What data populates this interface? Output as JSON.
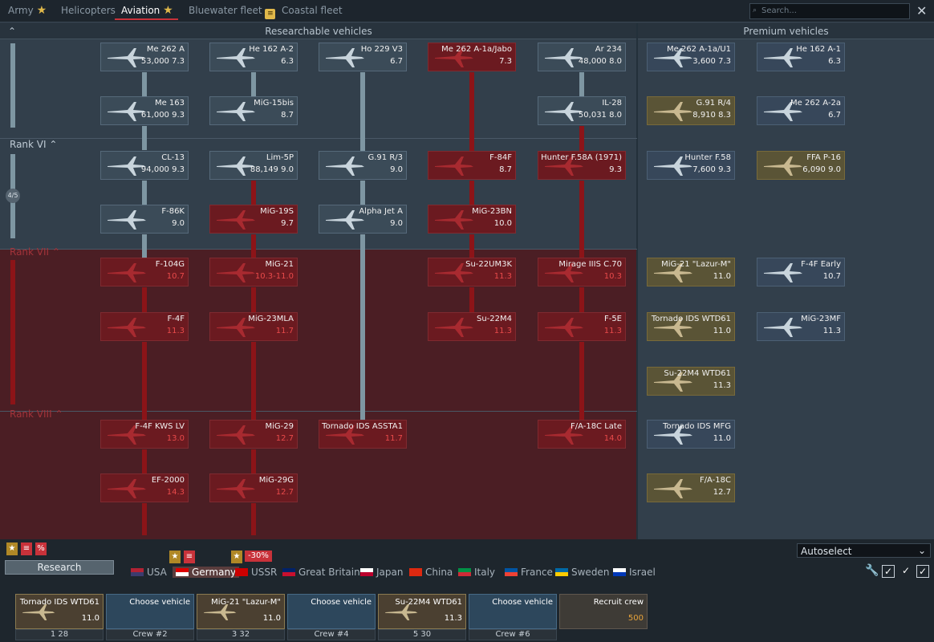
{
  "tabs": [
    {
      "label": "Army",
      "star": true
    },
    {
      "label": "Helicopters"
    },
    {
      "label": "Aviation",
      "star": true,
      "active": true
    },
    {
      "label": "Bluewater fleet",
      "book": true
    },
    {
      "label": "Coastal fleet"
    }
  ],
  "search": {
    "placeholder": "Search..."
  },
  "headers": {
    "research": "Researchable vehicles",
    "premium": "Premium vehicles"
  },
  "ranks": [
    {
      "label": "Rank VI",
      "red": false
    },
    {
      "label": "Rank VII",
      "red": true
    },
    {
      "label": "Rank VIII",
      "red": true
    }
  ],
  "rank_progress": "4/5",
  "vehicles": [
    {
      "name": "Me 262 A",
      "stat": "53,000 7.3",
      "col": 0,
      "row": 0,
      "type": "normal"
    },
    {
      "name": "He 162 A-2",
      "stat": "6.3",
      "col": 1,
      "row": 0,
      "type": "normal"
    },
    {
      "name": "Ho 229 V3",
      "stat": "6.7",
      "col": 2,
      "row": 0,
      "type": "normal"
    },
    {
      "name": "Me 262 A-1a/Jabo",
      "stat": "7.3",
      "col": 3,
      "row": 0,
      "type": "locked"
    },
    {
      "name": "Ar 234",
      "stat": "48,000 8.0",
      "col": 4,
      "row": 0,
      "type": "normal"
    },
    {
      "name": "Me 163",
      "stat": "61,000 9.3",
      "col": 0,
      "row": 1,
      "type": "normal"
    },
    {
      "name": "MiG-15bis",
      "stat": "8.7",
      "col": 1,
      "row": 1,
      "type": "normal"
    },
    {
      "name": "IL-28",
      "stat": "50,031 8.0",
      "col": 4,
      "row": 1,
      "type": "normal"
    },
    {
      "name": "CL-13",
      "stat": "94,000 9.3",
      "col": 0,
      "row": 2,
      "type": "normal"
    },
    {
      "name": "Lim-5P",
      "stat": "88,149 9.0",
      "col": 1,
      "row": 2,
      "type": "normal"
    },
    {
      "name": "G.91 R/3",
      "stat": "9.0",
      "col": 2,
      "row": 2,
      "type": "normal"
    },
    {
      "name": "F-84F",
      "stat": "8.7",
      "col": 3,
      "row": 2,
      "type": "locked"
    },
    {
      "name": "Hunter F.58A (1971)",
      "stat": "9.3",
      "col": 4,
      "row": 2,
      "type": "locked"
    },
    {
      "name": "F-86K",
      "stat": "9.0",
      "col": 0,
      "row": 3,
      "type": "normal"
    },
    {
      "name": "MiG-19S",
      "stat": "9.7",
      "col": 1,
      "row": 3,
      "type": "locked"
    },
    {
      "name": "Alpha Jet A",
      "stat": "9.0",
      "col": 2,
      "row": 3,
      "type": "normal"
    },
    {
      "name": "MiG-23BN",
      "stat": "10.0",
      "col": 3,
      "row": 3,
      "type": "locked"
    },
    {
      "name": "F-104G",
      "stat": "10.7",
      "col": 0,
      "row": 4,
      "type": "locked",
      "red": true
    },
    {
      "name": "MiG-21",
      "stat": "10.3-11.0",
      "col": 1,
      "row": 4,
      "type": "locked",
      "red": true
    },
    {
      "name": "Su-22UM3K",
      "stat": "11.3",
      "col": 3,
      "row": 4,
      "type": "locked",
      "red": true
    },
    {
      "name": "Mirage IIIS C.70",
      "stat": "10.3",
      "col": 4,
      "row": 4,
      "type": "locked",
      "red": true
    },
    {
      "name": "F-4F",
      "stat": "11.3",
      "col": 0,
      "row": 5,
      "type": "locked",
      "red": true
    },
    {
      "name": "MiG-23MLA",
      "stat": "11.7",
      "col": 1,
      "row": 5,
      "type": "locked",
      "red": true
    },
    {
      "name": "Su-22M4",
      "stat": "11.3",
      "col": 3,
      "row": 5,
      "type": "locked",
      "red": true
    },
    {
      "name": "F-5E",
      "stat": "11.3",
      "col": 4,
      "row": 5,
      "type": "locked",
      "red": true
    },
    {
      "name": "F-4F KWS LV",
      "stat": "13.0",
      "col": 0,
      "row": 7,
      "type": "locked",
      "red": true
    },
    {
      "name": "MiG-29",
      "stat": "12.7",
      "col": 1,
      "row": 7,
      "type": "locked",
      "red": true
    },
    {
      "name": "Tornado IDS ASSTA1",
      "stat": "11.7",
      "col": 2,
      "row": 7,
      "type": "locked",
      "red": true
    },
    {
      "name": "F/A-18C Late",
      "stat": "14.0",
      "col": 4,
      "row": 7,
      "type": "locked",
      "red": true
    },
    {
      "name": "EF-2000",
      "stat": "14.3",
      "col": 0,
      "row": 8,
      "type": "locked",
      "red": true
    },
    {
      "name": "MiG-29G",
      "stat": "12.7",
      "col": 1,
      "row": 8,
      "type": "locked",
      "red": true
    }
  ],
  "premium": [
    {
      "name": "Me 262 A-1a/U1",
      "stat": "3,600 7.3",
      "col": 0,
      "row": 0,
      "type": "premb"
    },
    {
      "name": "He 162 A-1",
      "stat": "6.3",
      "col": 1,
      "row": 0,
      "type": "premb"
    },
    {
      "name": "G.91 R/4",
      "stat": "8,910 8.3",
      "col": 0,
      "row": 1,
      "type": "prem"
    },
    {
      "name": "Me 262 A-2a",
      "stat": "6.7",
      "col": 1,
      "row": 1,
      "type": "premb"
    },
    {
      "name": "Hunter F.58",
      "stat": "7,600 9.3",
      "col": 0,
      "row": 2,
      "type": "premb"
    },
    {
      "name": "FFA P-16",
      "stat": "6,090 9.0",
      "col": 1,
      "row": 2,
      "type": "prem"
    },
    {
      "name": "MiG-21 \"Lazur-M\"",
      "stat": "11.0",
      "col": 0,
      "row": 4,
      "type": "prem"
    },
    {
      "name": "F-4F Early",
      "stat": "10.7",
      "col": 1,
      "row": 4,
      "type": "premb"
    },
    {
      "name": "Tornado IDS WTD61",
      "stat": "11.0",
      "col": 0,
      "row": 5,
      "type": "prem"
    },
    {
      "name": "MiG-23MF",
      "stat": "11.3",
      "col": 1,
      "row": 5,
      "type": "premb"
    },
    {
      "name": "Su-22M4 WTD61",
      "stat": "11.3",
      "col": 0,
      "row": 6,
      "type": "prem"
    },
    {
      "name": "Tornado IDS MFG",
      "stat": "11.0",
      "col": 0,
      "row": 7,
      "type": "premb"
    },
    {
      "name": "F/A-18C",
      "stat": "12.7",
      "col": 0,
      "row": 8,
      "type": "prem"
    }
  ],
  "research_label": "Research",
  "autoselect": "Autoselect",
  "discount": "-30%",
  "nations": [
    {
      "label": "USA",
      "c1": "#b22234",
      "c2": "#3c3b6e"
    },
    {
      "label": "Germany",
      "c1": "#dd0000",
      "c2": "#ffffff",
      "active": true
    },
    {
      "label": "USSR",
      "c1": "#cc0000",
      "c2": "#cc0000"
    },
    {
      "label": "Great Britain",
      "c1": "#012169",
      "c2": "#c8102e"
    },
    {
      "label": "Japan",
      "c1": "#ffffff",
      "c2": "#bc002d"
    },
    {
      "label": "China",
      "c1": "#de2910",
      "c2": "#de2910"
    },
    {
      "label": "Italy",
      "c1": "#009246",
      "c2": "#ce2b37"
    },
    {
      "label": "France",
      "c1": "#0055a4",
      "c2": "#ef4135"
    },
    {
      "label": "Sweden",
      "c1": "#006aa7",
      "c2": "#fecc00"
    },
    {
      "label": "Israel",
      "c1": "#ffffff",
      "c2": "#0038b8"
    }
  ],
  "crews": [
    {
      "name": "Tornado IDS WTD61",
      "br": "11.0",
      "foot": "1  28",
      "kind": "veh"
    },
    {
      "name": "Choose vehicle",
      "foot": "Crew #2",
      "kind": "choose"
    },
    {
      "name": "MiG-21 \"Lazur-M\"",
      "br": "11.0",
      "foot": "3  32",
      "kind": "veh"
    },
    {
      "name": "Choose vehicle",
      "foot": "Crew #4",
      "kind": "choose"
    },
    {
      "name": "Su-22M4 WTD61",
      "br": "11.3",
      "foot": "5  30",
      "kind": "veh"
    },
    {
      "name": "Choose vehicle",
      "foot": "Crew #6",
      "kind": "choose"
    },
    {
      "name": "Recruit crew",
      "br": "500",
      "kind": "recruit"
    }
  ]
}
